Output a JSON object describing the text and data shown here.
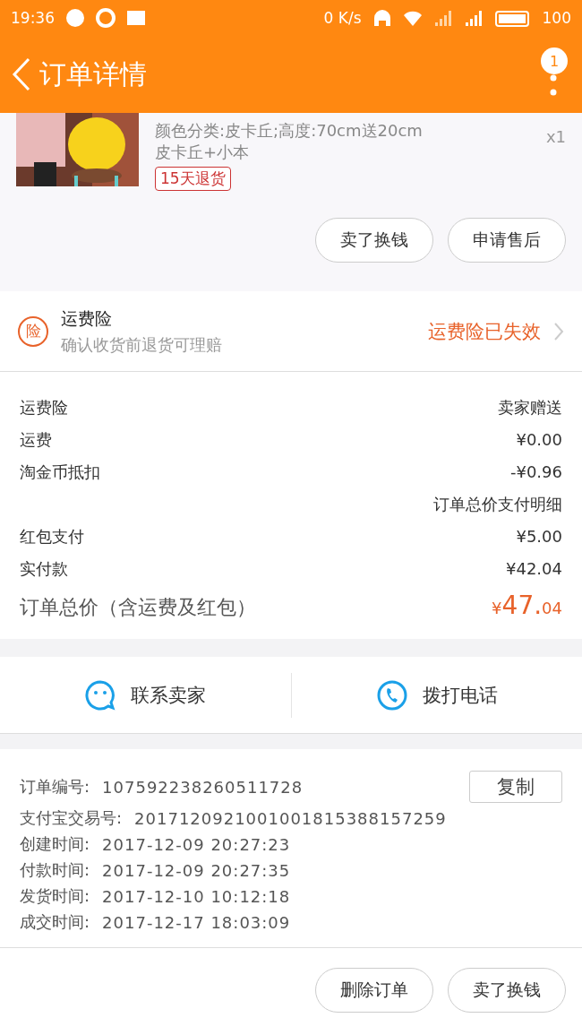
{
  "status_bar": {
    "time": "19:36",
    "speed": "0 K/s",
    "battery": "100"
  },
  "header": {
    "title": "订单详情",
    "badge": "1"
  },
  "product": {
    "spec_lines": [
      "颜色分类:皮卡丘;高度:70cm送20cm",
      "皮卡丘+小本"
    ],
    "quantity": "x1",
    "tag": "15天退货",
    "buttons": [
      "卖了换钱",
      "申请售后"
    ]
  },
  "insurance": {
    "icon": "险",
    "title": "运费险",
    "subtitle": "确认收货前退货可理赔",
    "status": "运费险已失效"
  },
  "costs": [
    {
      "label": "运费险",
      "value": "卖家赠送"
    },
    {
      "label": "运费",
      "value": "¥0.00"
    },
    {
      "label": "淘金币抵扣",
      "value": "-¥0.96"
    },
    {
      "value": "订单总价支付明细"
    },
    {
      "label": "红包支付",
      "value": "¥5.00"
    },
    {
      "label": "实付款",
      "value": "¥42.04"
    }
  ],
  "total": {
    "label": "订单总价（含运费及红包）",
    "currency": "¥",
    "integer": "47.",
    "decimal": "04"
  },
  "contact": [
    {
      "kind": "chat",
      "label": "联系卖家"
    },
    {
      "kind": "phone",
      "label": "拨打电话"
    }
  ],
  "info": [
    {
      "label": "订单编号:",
      "value": "107592238260511728"
    },
    {
      "label": "支付宝交易号:",
      "value": "2017120921001001815388157259"
    },
    {
      "label": "创建时间:",
      "value": "2017-12-09 20:27:23"
    },
    {
      "label": "付款时间:",
      "value": "2017-12-09 20:27:35"
    },
    {
      "label": "发货时间:",
      "value": "2017-12-10 10:12:18"
    },
    {
      "label": "成交时间:",
      "value": "2017-12-17 18:03:09"
    }
  ],
  "copy_button": "复制",
  "footer_buttons": [
    "删除订单",
    "卖了换钱"
  ]
}
